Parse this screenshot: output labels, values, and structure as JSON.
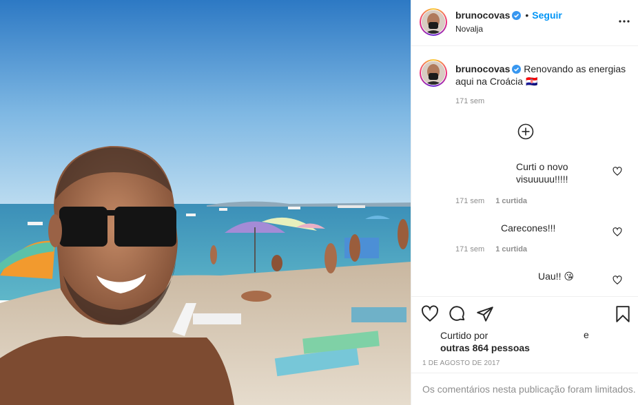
{
  "post": {
    "username": "brunocovas",
    "follow_label": "Seguir",
    "dot": "•",
    "location": "Novalja"
  },
  "caption": {
    "username": "brunocovas",
    "text": "Renovando as energias aqui na Croácia 🇭🇷",
    "time": "171 sem"
  },
  "comments": [
    {
      "text": "Curti o novo visuuuuu!!!!!",
      "time": "171 sem",
      "likes": "1 curtida"
    },
    {
      "text": "Carecones!!!",
      "time": "171 sem",
      "likes": "1 curtida"
    },
    {
      "text": "Uau!! 😘"
    }
  ],
  "likes": {
    "prefix": "Curtido por",
    "others": "outras 864 pessoas",
    "conjunction": "e"
  },
  "date": "1 DE AGOSTO DE 2017",
  "comments_limited": "Os comentários nesta publicação foram limitados.",
  "colors": {
    "link": "#0095f6",
    "verified": "#3897f0",
    "muted": "#8e8e8e"
  },
  "icons": [
    "more-options-icon",
    "verified-badge-icon",
    "load-more-comments-icon",
    "heart-icon",
    "comment-icon",
    "share-icon",
    "bookmark-icon"
  ]
}
